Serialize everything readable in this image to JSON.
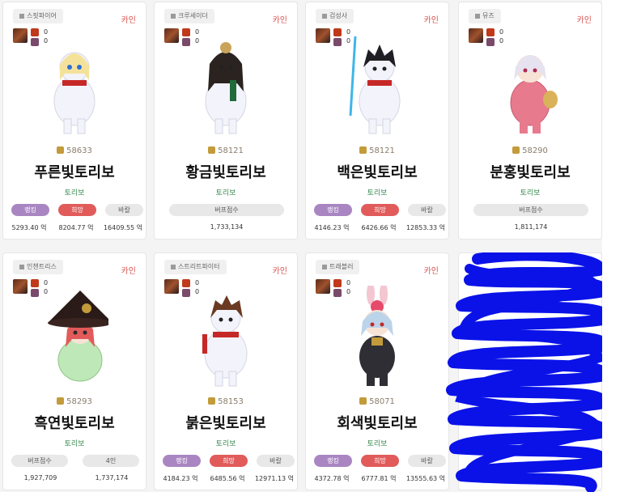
{
  "cards": [
    {
      "job": "스핏파이어",
      "server": "카인",
      "equip": {
        "v1": "0",
        "v2": "0"
      },
      "level": "58633",
      "name": "푸른빛토리보",
      "guild": "토리보",
      "pills": [
        "랭킹",
        "희망",
        "바칼"
      ],
      "values": [
        "5293.40 억",
        "8204.77 억",
        "16409.55 억"
      ],
      "colors": {
        "hair": "#f5e29a",
        "body": "#f3f3fb",
        "scarf": "#c62828"
      }
    },
    {
      "job": "크루세이더",
      "server": "카인",
      "equip": {
        "v1": "0",
        "v2": "0"
      },
      "level": "58121",
      "name": "황금빛토리보",
      "guild": "토리보",
      "pills": [
        "버프점수"
      ],
      "values": [
        "1,733,134"
      ],
      "colors": {
        "hair": "#2a2320",
        "body": "#f3f3fb",
        "scarf": "#1f6b3a"
      }
    },
    {
      "job": "검성사",
      "server": "카인",
      "equip": {
        "v1": "0",
        "v2": "0"
      },
      "level": "58121",
      "name": "백은빛토리보",
      "guild": "토리보",
      "pills": [
        "랭킹",
        "희망",
        "바칼"
      ],
      "values": [
        "4146.23 억",
        "6426.66 억",
        "12853.33 억"
      ],
      "colors": {
        "hair": "#1e1e24",
        "body": "#f3f3fb",
        "scarf": "#c62828"
      }
    },
    {
      "job": "뮤즈",
      "server": "카인",
      "equip": {
        "v1": "0",
        "v2": "0"
      },
      "level": "58290",
      "name": "분홍빛토리보",
      "guild": "토리보",
      "pills": [
        "버프점수"
      ],
      "values": [
        "1,811,174"
      ],
      "colors": {
        "hair": "#e7e2ef",
        "body": "#e87a8e",
        "scarf": "#c0392b"
      }
    },
    {
      "job": "인챈트리스",
      "server": "카인",
      "equip": {
        "v1": "0",
        "v2": "0"
      },
      "level": "58293",
      "name": "흑연빛토리보",
      "guild": "토리보",
      "pills": [
        "버프점수",
        "4인"
      ],
      "values": [
        "1,927,709",
        "1,737,174"
      ],
      "colors": {
        "hair": "#e35a5a",
        "body": "#bfe8b8",
        "scarf": "#3a8a3a"
      }
    },
    {
      "job": "스트리트파이터",
      "server": "카인",
      "equip": {
        "v1": "0",
        "v2": "0"
      },
      "level": "58153",
      "name": "붉은빛토리보",
      "guild": "토리보",
      "pills": [
        "랭킹",
        "희망",
        "바칼"
      ],
      "values": [
        "4184.23 억",
        "6485.56 억",
        "12971.13 억"
      ],
      "colors": {
        "hair": "#6b3a22",
        "body": "#f3f3fb",
        "scarf": "#c62828"
      }
    },
    {
      "job": "트래블러",
      "server": "카인",
      "equip": {
        "v1": "0",
        "v2": "0"
      },
      "level": "58071",
      "name": "회색빛토리보",
      "guild": "토리보",
      "pills": [
        "랭킹",
        "희망",
        "바칼"
      ],
      "values": [
        "4372.78 억",
        "6777.81 억",
        "13555.63 억"
      ],
      "colors": {
        "hair": "#bcd4ea",
        "body": "#2e2e34",
        "scarf": "#c39b3a"
      }
    }
  ]
}
